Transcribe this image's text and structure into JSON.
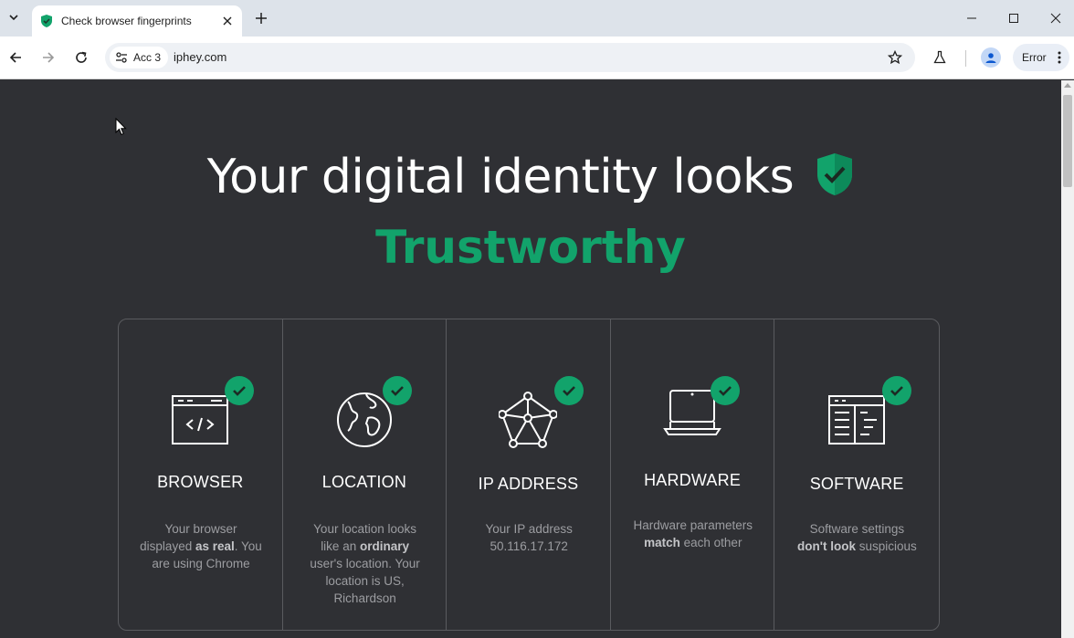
{
  "browser": {
    "tab_title": "Check browser fingerprints",
    "profile_chip": "Acc 3",
    "url": "iphey.com",
    "error_button": "Error"
  },
  "colors": {
    "page_background": "#2f3034",
    "accent_green": "#12a36b",
    "text_muted": "#9c9da1"
  },
  "hero": {
    "headline": "Your digital identity looks",
    "verdict": "Trustworthy"
  },
  "cards": [
    {
      "icon": "browser-code-icon",
      "label": "BROWSER",
      "desc_1": "Your browser displayed ",
      "desc_bold": "as real",
      "desc_2": ". You are using Chrome"
    },
    {
      "icon": "globe-icon",
      "label": "LOCATION",
      "desc_1": "Your location looks like an ",
      "desc_bold": "ordinary",
      "desc_2": " user's location. Your location is US, Richardson"
    },
    {
      "icon": "network-icon",
      "label": "IP ADDRESS",
      "desc_1": "Your IP address 50.116.17.172",
      "desc_bold": "",
      "desc_2": ""
    },
    {
      "icon": "laptop-icon",
      "label": "HARDWARE",
      "desc_1": "Hardware parameters ",
      "desc_bold": "match",
      "desc_2": " each other"
    },
    {
      "icon": "software-window-icon",
      "label": "SOFTWARE",
      "desc_1": "Software settings ",
      "desc_bold": "don't look",
      "desc_2": " suspicious"
    }
  ]
}
